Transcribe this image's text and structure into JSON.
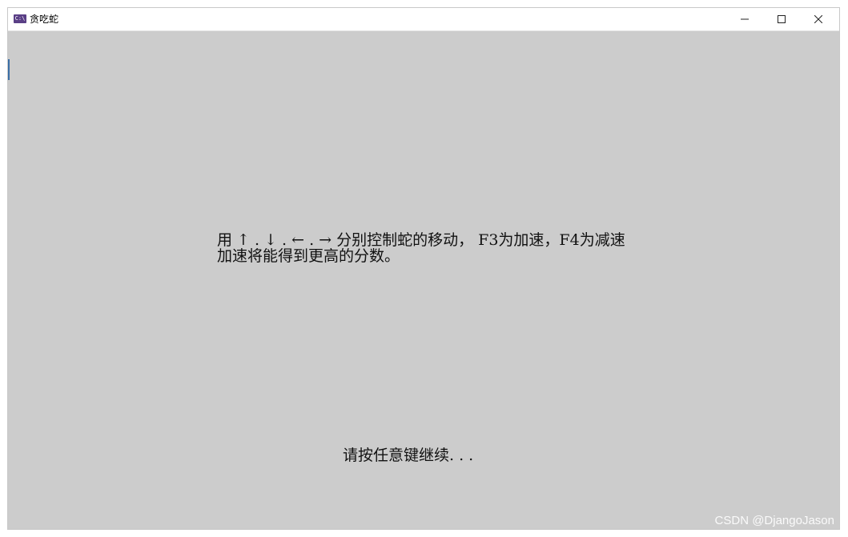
{
  "window": {
    "title": "贪吃蛇",
    "icon_label": "C:\\",
    "controls": {
      "minimize": "minimize",
      "maximize": "maximize",
      "close": "close"
    }
  },
  "console": {
    "instruction_line_1": "用 ↑ . ↓ . ← . → 分别控制蛇的移动， F3为加速，F4为减速",
    "instruction_line_2": "加速将能得到更高的分数。",
    "prompt": "请按任意键继续. . ."
  },
  "watermark": "CSDN @DjangoJason",
  "colors": {
    "console_background": "#cccccc",
    "console_text": "#111111",
    "titlebar_background": "#ffffff",
    "app_icon": "#5a3f86"
  }
}
